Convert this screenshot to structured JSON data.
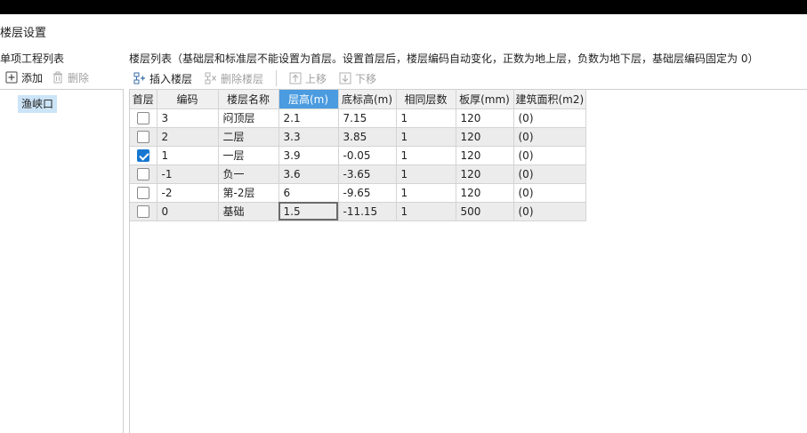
{
  "window": {
    "title": "楼层设置"
  },
  "left": {
    "header": "单项工程列表",
    "toolbar": {
      "add_label": "添加",
      "delete_label": "删除"
    },
    "tree": [
      {
        "label": "渔峡口"
      }
    ]
  },
  "right": {
    "header": "楼层列表（基础层和标准层不能设置为首层。设置首层后，楼层编码自动变化，正数为地上层，负数为地下层，基础层编码固定为 0）",
    "toolbar": {
      "insert_label": "插入楼层",
      "delete_label": "删除楼层",
      "up_label": "上移",
      "down_label": "下移"
    },
    "columns": [
      "首层",
      "编码",
      "楼层名称",
      "层高(m)",
      "底标高(m)",
      "相同层数",
      "板厚(mm)",
      "建筑面积(m2)"
    ],
    "rows": [
      {
        "first": false,
        "code": "3",
        "name": "闷顶层",
        "height": "2.1",
        "bottom": "7.15",
        "same": "1",
        "slab": "120",
        "area": "(0)"
      },
      {
        "first": false,
        "code": "2",
        "name": "二层",
        "height": "3.3",
        "bottom": "3.85",
        "same": "1",
        "slab": "120",
        "area": "(0)"
      },
      {
        "first": true,
        "code": "1",
        "name": "一层",
        "height": "3.9",
        "bottom": "-0.05",
        "same": "1",
        "slab": "120",
        "area": "(0)"
      },
      {
        "first": false,
        "code": "-1",
        "name": "负一",
        "height": "3.6",
        "bottom": "-3.65",
        "same": "1",
        "slab": "120",
        "area": "(0)"
      },
      {
        "first": false,
        "code": "-2",
        "name": "第-2层",
        "height": "6",
        "bottom": "-9.65",
        "same": "1",
        "slab": "120",
        "area": "(0)"
      },
      {
        "first": false,
        "code": "0",
        "name": "基础",
        "height": "1.5",
        "bottom": "-11.15",
        "same": "1",
        "slab": "500",
        "area": "(0)"
      }
    ]
  },
  "colors": {
    "accent": "#4a9be0",
    "checkbox_on": "#1677d2",
    "selection": "#cce4f7"
  }
}
